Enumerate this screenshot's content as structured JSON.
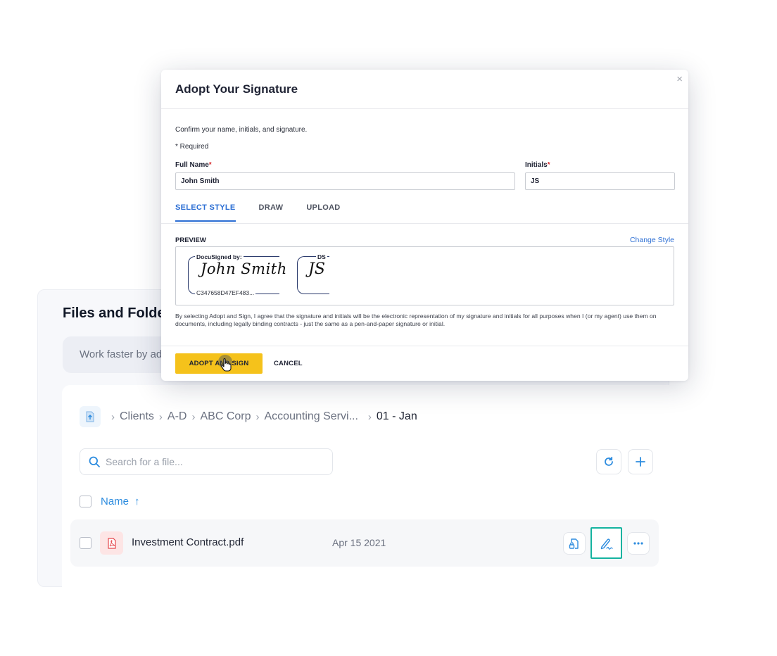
{
  "files": {
    "title": "Files and Folders",
    "banner_text": "Work faster by adding",
    "breadcrumb": [
      "Clients",
      "A-D",
      "ABC Corp",
      "Accounting Servi...",
      "01 - Jan"
    ],
    "search_placeholder": "Search for a file...",
    "column_name": "Name",
    "sort_arrow": "↑",
    "rows": [
      {
        "name": "Investment Contract.pdf",
        "date": "Apr 15 2021"
      }
    ]
  },
  "modal": {
    "title": "Adopt Your Signature",
    "close": "×",
    "confirm_text": "Confirm your name, initials, and signature.",
    "required_text": "* Required",
    "full_name_label": "Full Name",
    "full_name_value": "John Smith",
    "initials_label": "Initials",
    "initials_value": "JS",
    "required_mark": "*",
    "tabs": [
      "SELECT STYLE",
      "DRAW",
      "UPLOAD"
    ],
    "preview_label": "PREVIEW",
    "change_style": "Change Style",
    "signature_caption": "DocuSigned by:",
    "signature_script": "John Smith",
    "signature_id": "C347658D47EF483...",
    "initials_caption": "DS",
    "initials_script": "JS",
    "legal_text": "By selecting Adopt and Sign, I agree that the signature and initials will be the electronic representation of my signature and initials for all purposes when I (or my agent) use them on documents, including legally binding contracts - just the same as a pen-and-paper signature or initial.",
    "adopt_button": "ADOPT AND SIGN",
    "cancel_button": "CANCEL"
  },
  "colors": {
    "accent_blue": "#2d8cdf",
    "docusign_blue": "#2d6fd4",
    "adopt_yellow": "#f5c21b",
    "highlight_teal": "#14b3a0",
    "pdf_red": "#e5484d"
  },
  "icons": [
    "upload-home-icon",
    "search-icon",
    "refresh-icon",
    "plus-icon",
    "pdf-icon",
    "document-lock-icon",
    "signature-pen-icon",
    "more-dots-icon",
    "close-icon",
    "hand-cursor-icon"
  ]
}
